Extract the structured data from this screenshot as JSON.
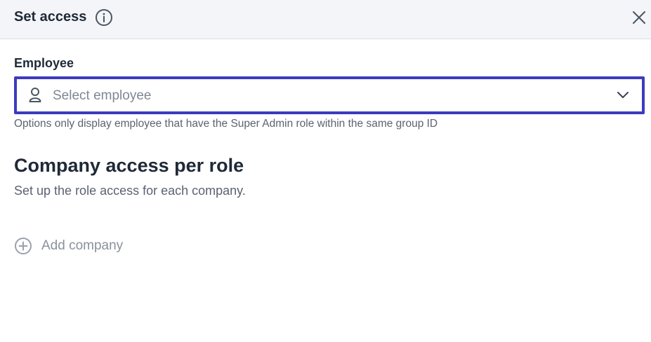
{
  "header": {
    "title": "Set access",
    "info_icon": "info-circle-icon",
    "close_icon": "close-icon"
  },
  "employee_field": {
    "label": "Employee",
    "placeholder": "Select employee",
    "person_icon": "person-icon",
    "chevron_icon": "chevron-down-icon",
    "help_text": "Options only display employee that have the Super Admin role within the same group ID"
  },
  "company_access": {
    "title": "Company access per role",
    "subtitle": "Set up the role access for each company.",
    "add_button_label": "Add company",
    "add_icon": "plus-circle-icon"
  },
  "colors": {
    "header_bg": "#f3f5f8",
    "focus_border": "#3d3bbf",
    "muted_text": "#8a919c"
  }
}
